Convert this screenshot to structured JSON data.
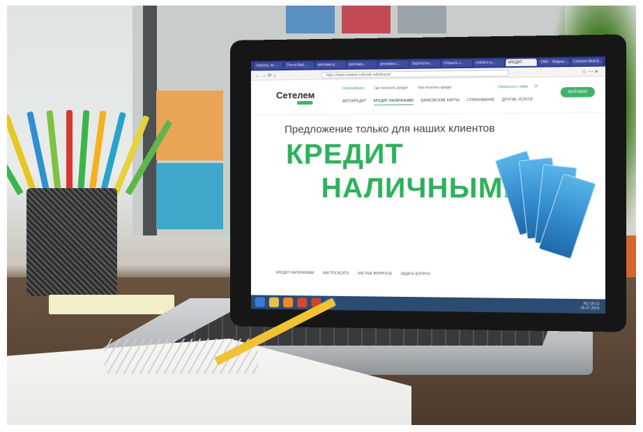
{
  "browser": {
    "tabs": [
      "Україна, по…",
      "Почта Mail…",
      "реклама в…",
      "реклама…",
      "реклама с…",
      "Зарплатно…",
      "Открыть с…",
      "cetelem.ru…",
      "КРЕДИТ",
      "СМС - Яндекс…",
      "Cetelem Мой Б…"
    ],
    "active_tab_index": 8,
    "url": "https://www.cetelem.ru/kredit-nalichnymi/"
  },
  "site": {
    "logo": "Сетелем",
    "region": "Новосибирск",
    "top_links": [
      "Где получить кредит",
      "Как погасить кредит"
    ],
    "contact_link": "Связаться с нами",
    "nav": [
      "АВТОКРЕДИТ",
      "КРЕДИТ НАЛИЧНЫМИ",
      "БАНКОВСКИЕ КАРТЫ",
      "СТРАХОВАНИЕ",
      "ДРУГИЕ УСЛУГИ"
    ],
    "active_nav_index": 1,
    "mybank_button": "МОЙ БАНК",
    "promo_subtitle": "Предложение только для наших клиентов",
    "promo_title_line1": "КРЕДИТ",
    "promo_title_line2": "НАЛИЧНЫМИ",
    "subnav": [
      "КРЕДИТ НАЛИЧНЫМИ",
      "КАК ПОГАСИТЬ",
      "ЧАСТЫЕ ВОПРОСЫ",
      "ЗАДАТЬ ВОПРОС"
    ]
  },
  "taskbar": {
    "time": "19:12",
    "date": "26.07.2019",
    "lang": "RU"
  },
  "colors": {
    "brand_green": "#2db25b",
    "taskbar_blue": "#2c4b70",
    "tab_bar": "#2d3a8c"
  },
  "icons": [
    "search-icon",
    "taskbar-ie-icon",
    "taskbar-explorer-icon",
    "taskbar-media-icon",
    "taskbar-chrome-icon",
    "taskbar-paint-icon",
    "taskbar-word-icon"
  ]
}
